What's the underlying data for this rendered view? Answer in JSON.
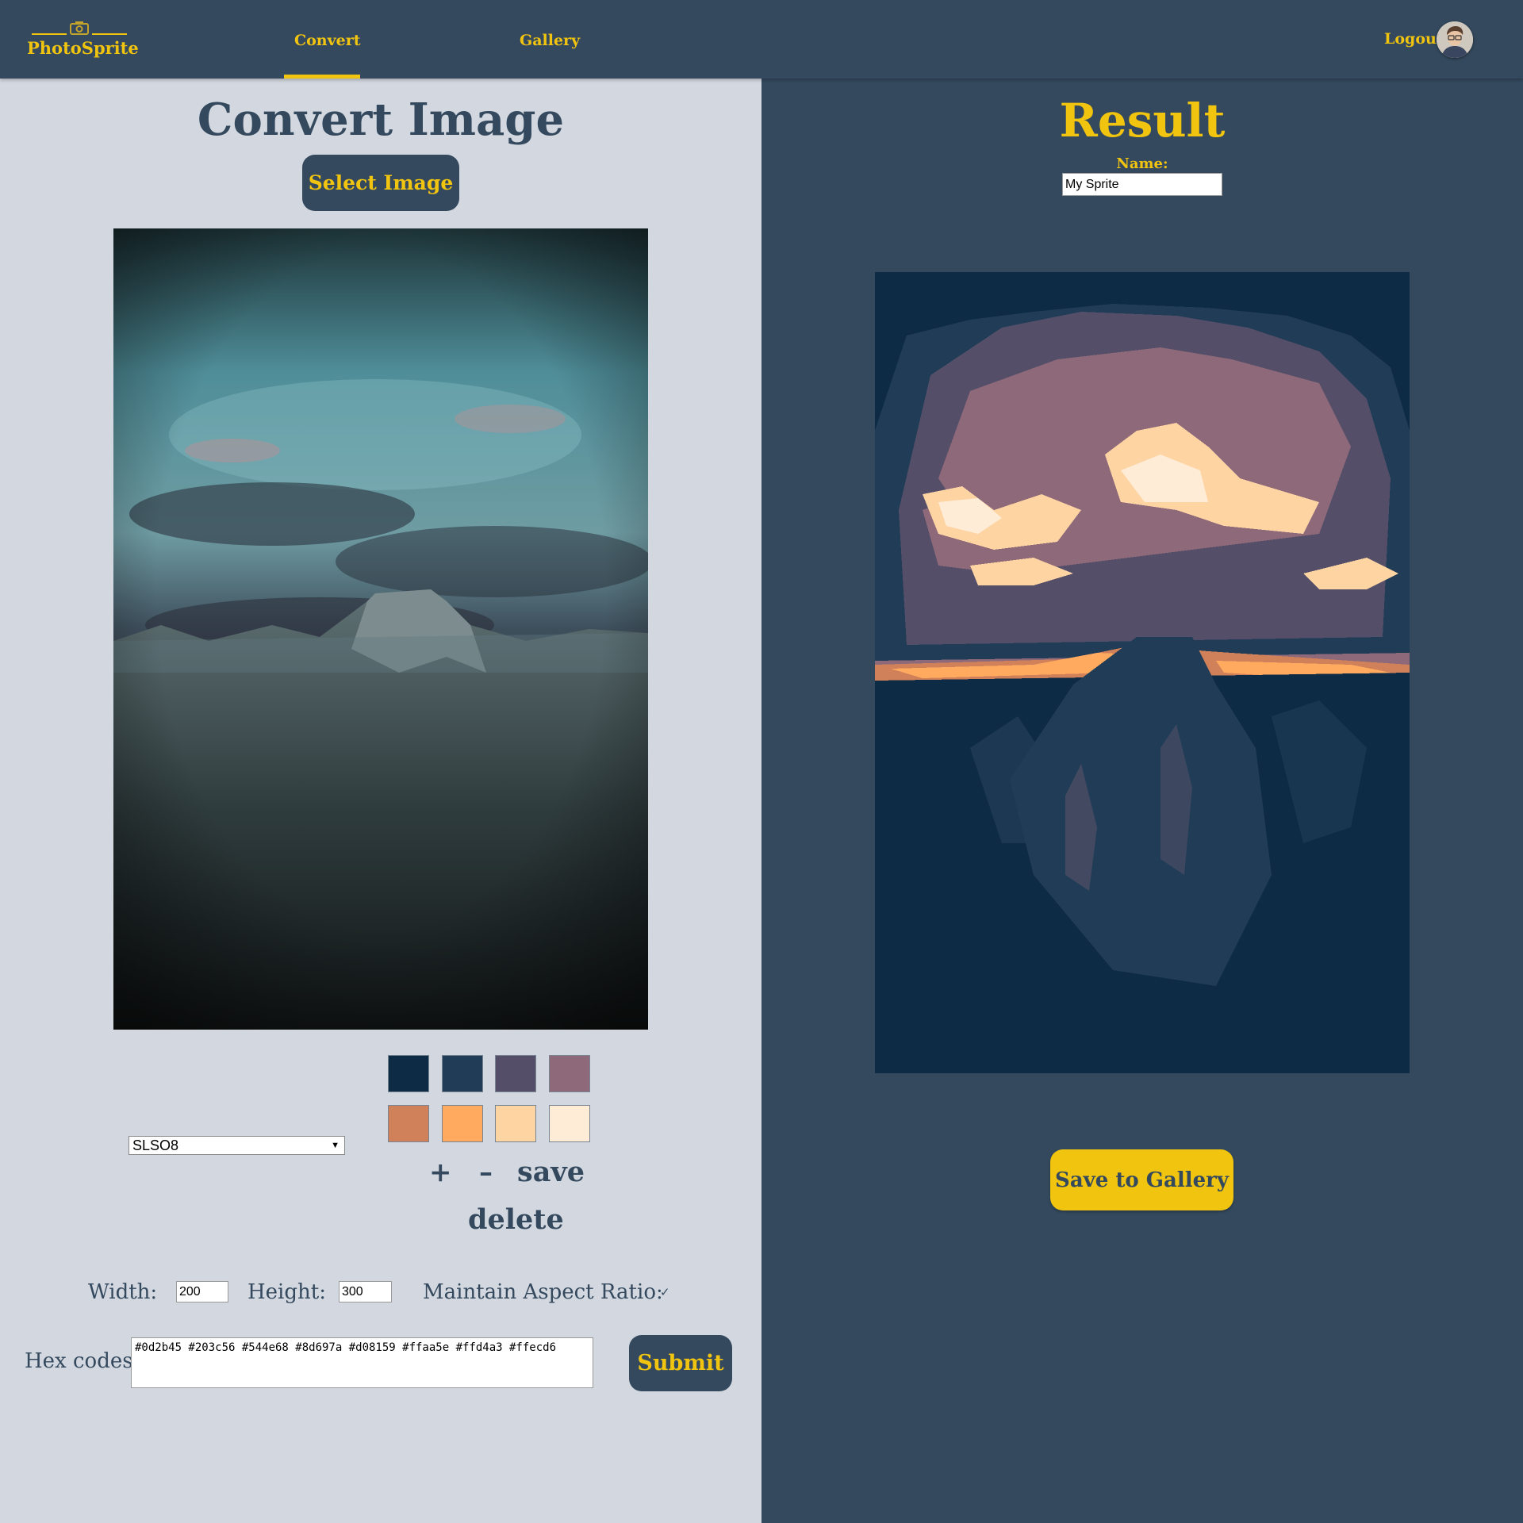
{
  "nav": {
    "logo_text": "PhotoSprite",
    "links": [
      {
        "label": "Convert",
        "active": true
      },
      {
        "label": "Gallery",
        "active": false
      }
    ],
    "logout_label": "Logout",
    "accent_color": "#f1c40f",
    "bar_color": "#34495e"
  },
  "convert": {
    "title": "Convert Image",
    "select_button": "Select Image",
    "palette_name": "SLSO8",
    "swatches": [
      "#0d2b45",
      "#203c56",
      "#544e68",
      "#8d697a",
      "#d08159",
      "#ffaa5e",
      "#ffd4a3",
      "#ffecd6"
    ],
    "add_label": "+",
    "remove_label": "–",
    "save_label": "save",
    "delete_label": "delete",
    "width_label": "Width:",
    "width_value": "200",
    "height_label": "Height:",
    "height_value": "300",
    "aspect_label": "Maintain Aspect Ratio:",
    "aspect_checked": true,
    "hex_label": "Hex codes:",
    "hex_value": "#0d2b45 #203c56 #544e68 #8d697a #d08159 #ffaa5e #ffd4a3 #ffecd6",
    "submit_label": "Submit"
  },
  "result": {
    "title": "Result",
    "name_label": "Name:",
    "name_value": "My Sprite",
    "save_button": "Save to Gallery"
  }
}
